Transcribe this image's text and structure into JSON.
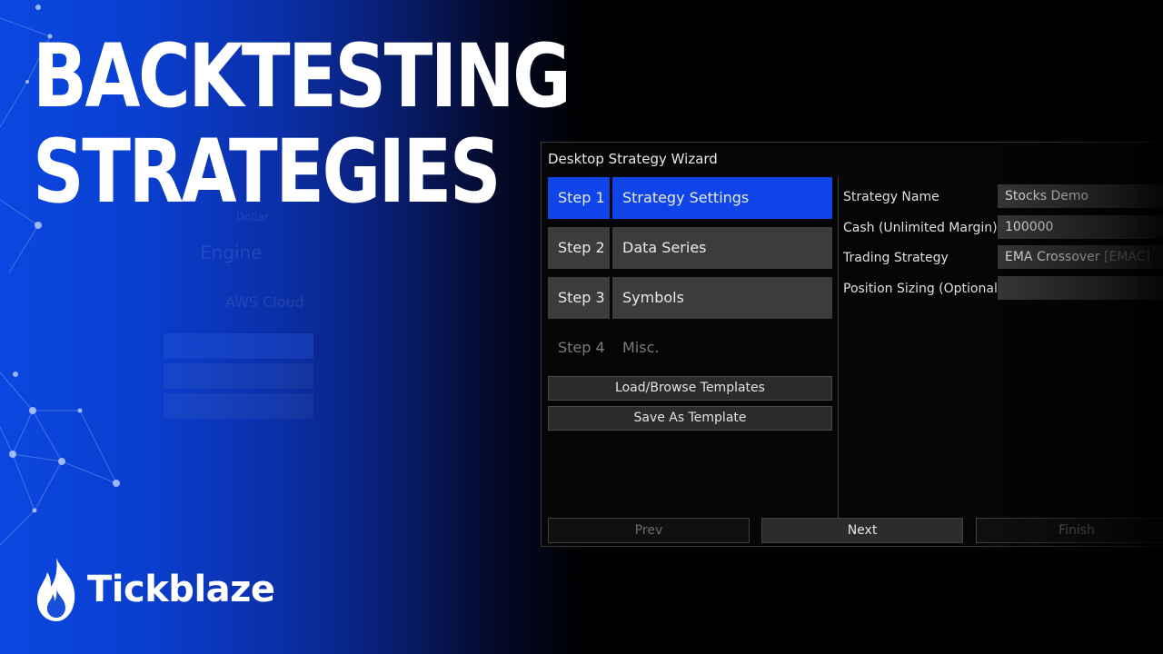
{
  "headline": {
    "line1": "BACKTESTING",
    "line2": "STRATEGIES"
  },
  "brand": {
    "name": "Tickblaze",
    "icon": "flame-icon"
  },
  "background_ghost": {
    "engine_label": "Engine",
    "cloud_label": "AWS Cloud",
    "dollar_label": "Dollar"
  },
  "wizard": {
    "title": "Desktop Strategy Wizard",
    "steps": [
      {
        "num": "Step 1",
        "label": "Strategy Settings",
        "state": "active"
      },
      {
        "num": "Step 2",
        "label": "Data Series",
        "state": "normal"
      },
      {
        "num": "Step 3",
        "label": "Symbols",
        "state": "normal"
      },
      {
        "num": "Step 4",
        "label": "Misc.",
        "state": "disabled"
      }
    ],
    "template_buttons": {
      "load": "Load/Browse Templates",
      "save": "Save As Template"
    },
    "properties": [
      {
        "label": "Strategy Name",
        "value": "Stocks Demo"
      },
      {
        "label": "Cash (Unlimited Margin)",
        "value": "100000"
      },
      {
        "label": "Trading Strategy",
        "value": "EMA Crossover",
        "suffix": "[EMAC]"
      },
      {
        "label": "Position Sizing (Optional)",
        "value": ""
      }
    ],
    "nav": {
      "prev": "Prev",
      "next": "Next",
      "finish": "Finish"
    }
  },
  "colors": {
    "accent_blue": "#0f45e8",
    "background_blue": "#0b47e0",
    "step_gray": "#3c3c3c"
  }
}
